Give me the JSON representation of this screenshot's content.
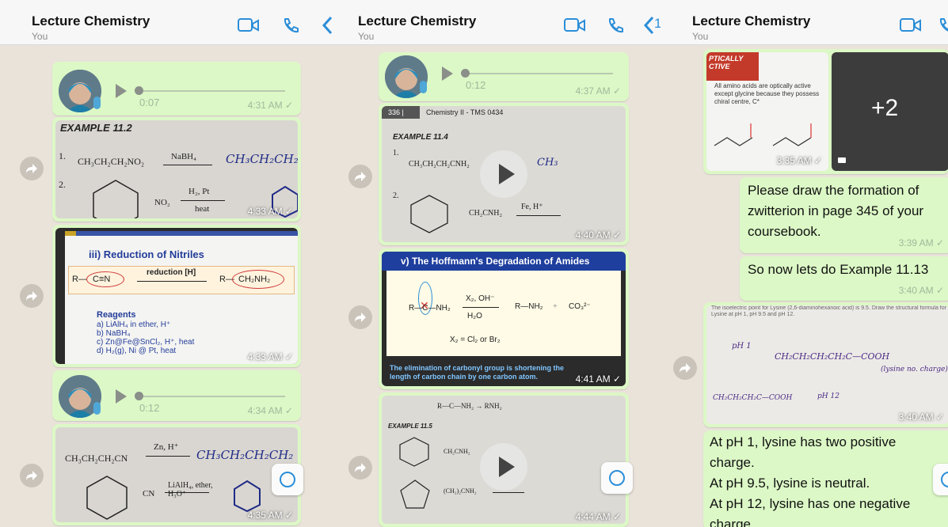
{
  "chat": {
    "title": "Lecture Chemistry",
    "subtitle": "You"
  },
  "colors": {
    "accent": "#2b8ed8",
    "bubble": "#dcf8c6",
    "background": "#e9e3da"
  },
  "panel1": {
    "voice1": {
      "duration": "0:07",
      "time": "4:31 AM ✓"
    },
    "img1": {
      "heading": "EXAMPLE 11.2",
      "row1": "CH₃CH₂CH₂NO₂",
      "reagent1": "NaBH₄",
      "hand1": "CH₃CH₂CH₂",
      "reagent2": "H₂, Pt",
      "heat": "heat",
      "nitro": "NO₂",
      "time": "4:33 AM ✓"
    },
    "img2": {
      "title": "iii)   Reduction of Nitriles",
      "arrow": "reduction [H]",
      "reagents_title": "Reagents",
      "reagents": [
        "a) LiAlH₄ in ether, H⁺",
        "b) NaBH₄",
        "c) Zn@Fe@SnCl₂, H⁺, heat",
        "d) H₂(g), Ni @ Pt, heat"
      ],
      "time": "4:33 AM ✓"
    },
    "voice2": {
      "duration": "0:12",
      "time": "4:34 AM ✓"
    },
    "img3": {
      "row1": "CH₃CH₂CH₂CN",
      "reagent1": "Zn, H⁺",
      "hand1": "CH₃CH₂CH₂CH₂",
      "cn": "CN",
      "reagent2": "LiAlH₄, ether, H₃O⁺",
      "time": "4:35 AM ✓"
    }
  },
  "panel2": {
    "back_count": "1",
    "voice1": {
      "duration": "0:12",
      "time": "4:37 AM ✓"
    },
    "img1": {
      "page": "336 |",
      "course": "Chemistry II - TMS 0434",
      "heading": "EXAMPLE 11.4",
      "row1": "CH₃CH₂CH₂CNH₂",
      "hand1": "CH₃",
      "reagent": "Fe, H⁺",
      "row2": "CH₂CNH₂",
      "time": "4:40 AM ✓"
    },
    "img2": {
      "title": "v) The Hoffmann's Degradation of Amides",
      "reagent": "X₂, OH⁻",
      "product1": "R—NH₂",
      "product2": "CO₃²⁻",
      "water": "H₂O",
      "x": "X₂ = Cl₂ or Br₂",
      "note": "The elimination of carbonyl group is shortening the length of carbon chain by one carbon atom.",
      "time": "4:41 AM ✓"
    },
    "img3": {
      "heading": "EXAMPLE 11.5",
      "row0": "R—C—NH₂ → RNH₂",
      "row1": "CH₂CNH₂",
      "row2": "(CH₂)₂CNH₂",
      "time": "4:44 AM ✓"
    }
  },
  "panel3": {
    "img1": {
      "title": "PTICALLY CTIVE",
      "line1": "All amino acids are optically active",
      "line2": "except glycine because they possess",
      "line3": "chiral centre, C*",
      "more": "+2",
      "time": "3:35 AM ✓"
    },
    "msg1": {
      "text": "Please draw the formation of zwitterion in page 345 of your coursebook.",
      "time": "3:39 AM ✓"
    },
    "msg2": {
      "text": "So now lets do Example 11.13",
      "time": "3:40 AM ✓"
    },
    "img2": {
      "caption": "The isoelectric point for Lysine (2,6-diaminohexanoic acid) is 9.5. Draw the structural formula for Lysine at pH 1, pH 9.5 and pH 12.",
      "hand1": "CH₂CH₂CH₂CH₂C—COOH",
      "hand2": "(lysine no. charge)",
      "time": "3:40 AM ✓"
    },
    "msg3": {
      "line1": "At pH 1, lysine has two positive",
      "line2": "charge.",
      "line3": "At pH 9.5, lysine is neutral.",
      "line4": "At pH 12, lysine has one negative",
      "line5": "charge."
    }
  }
}
